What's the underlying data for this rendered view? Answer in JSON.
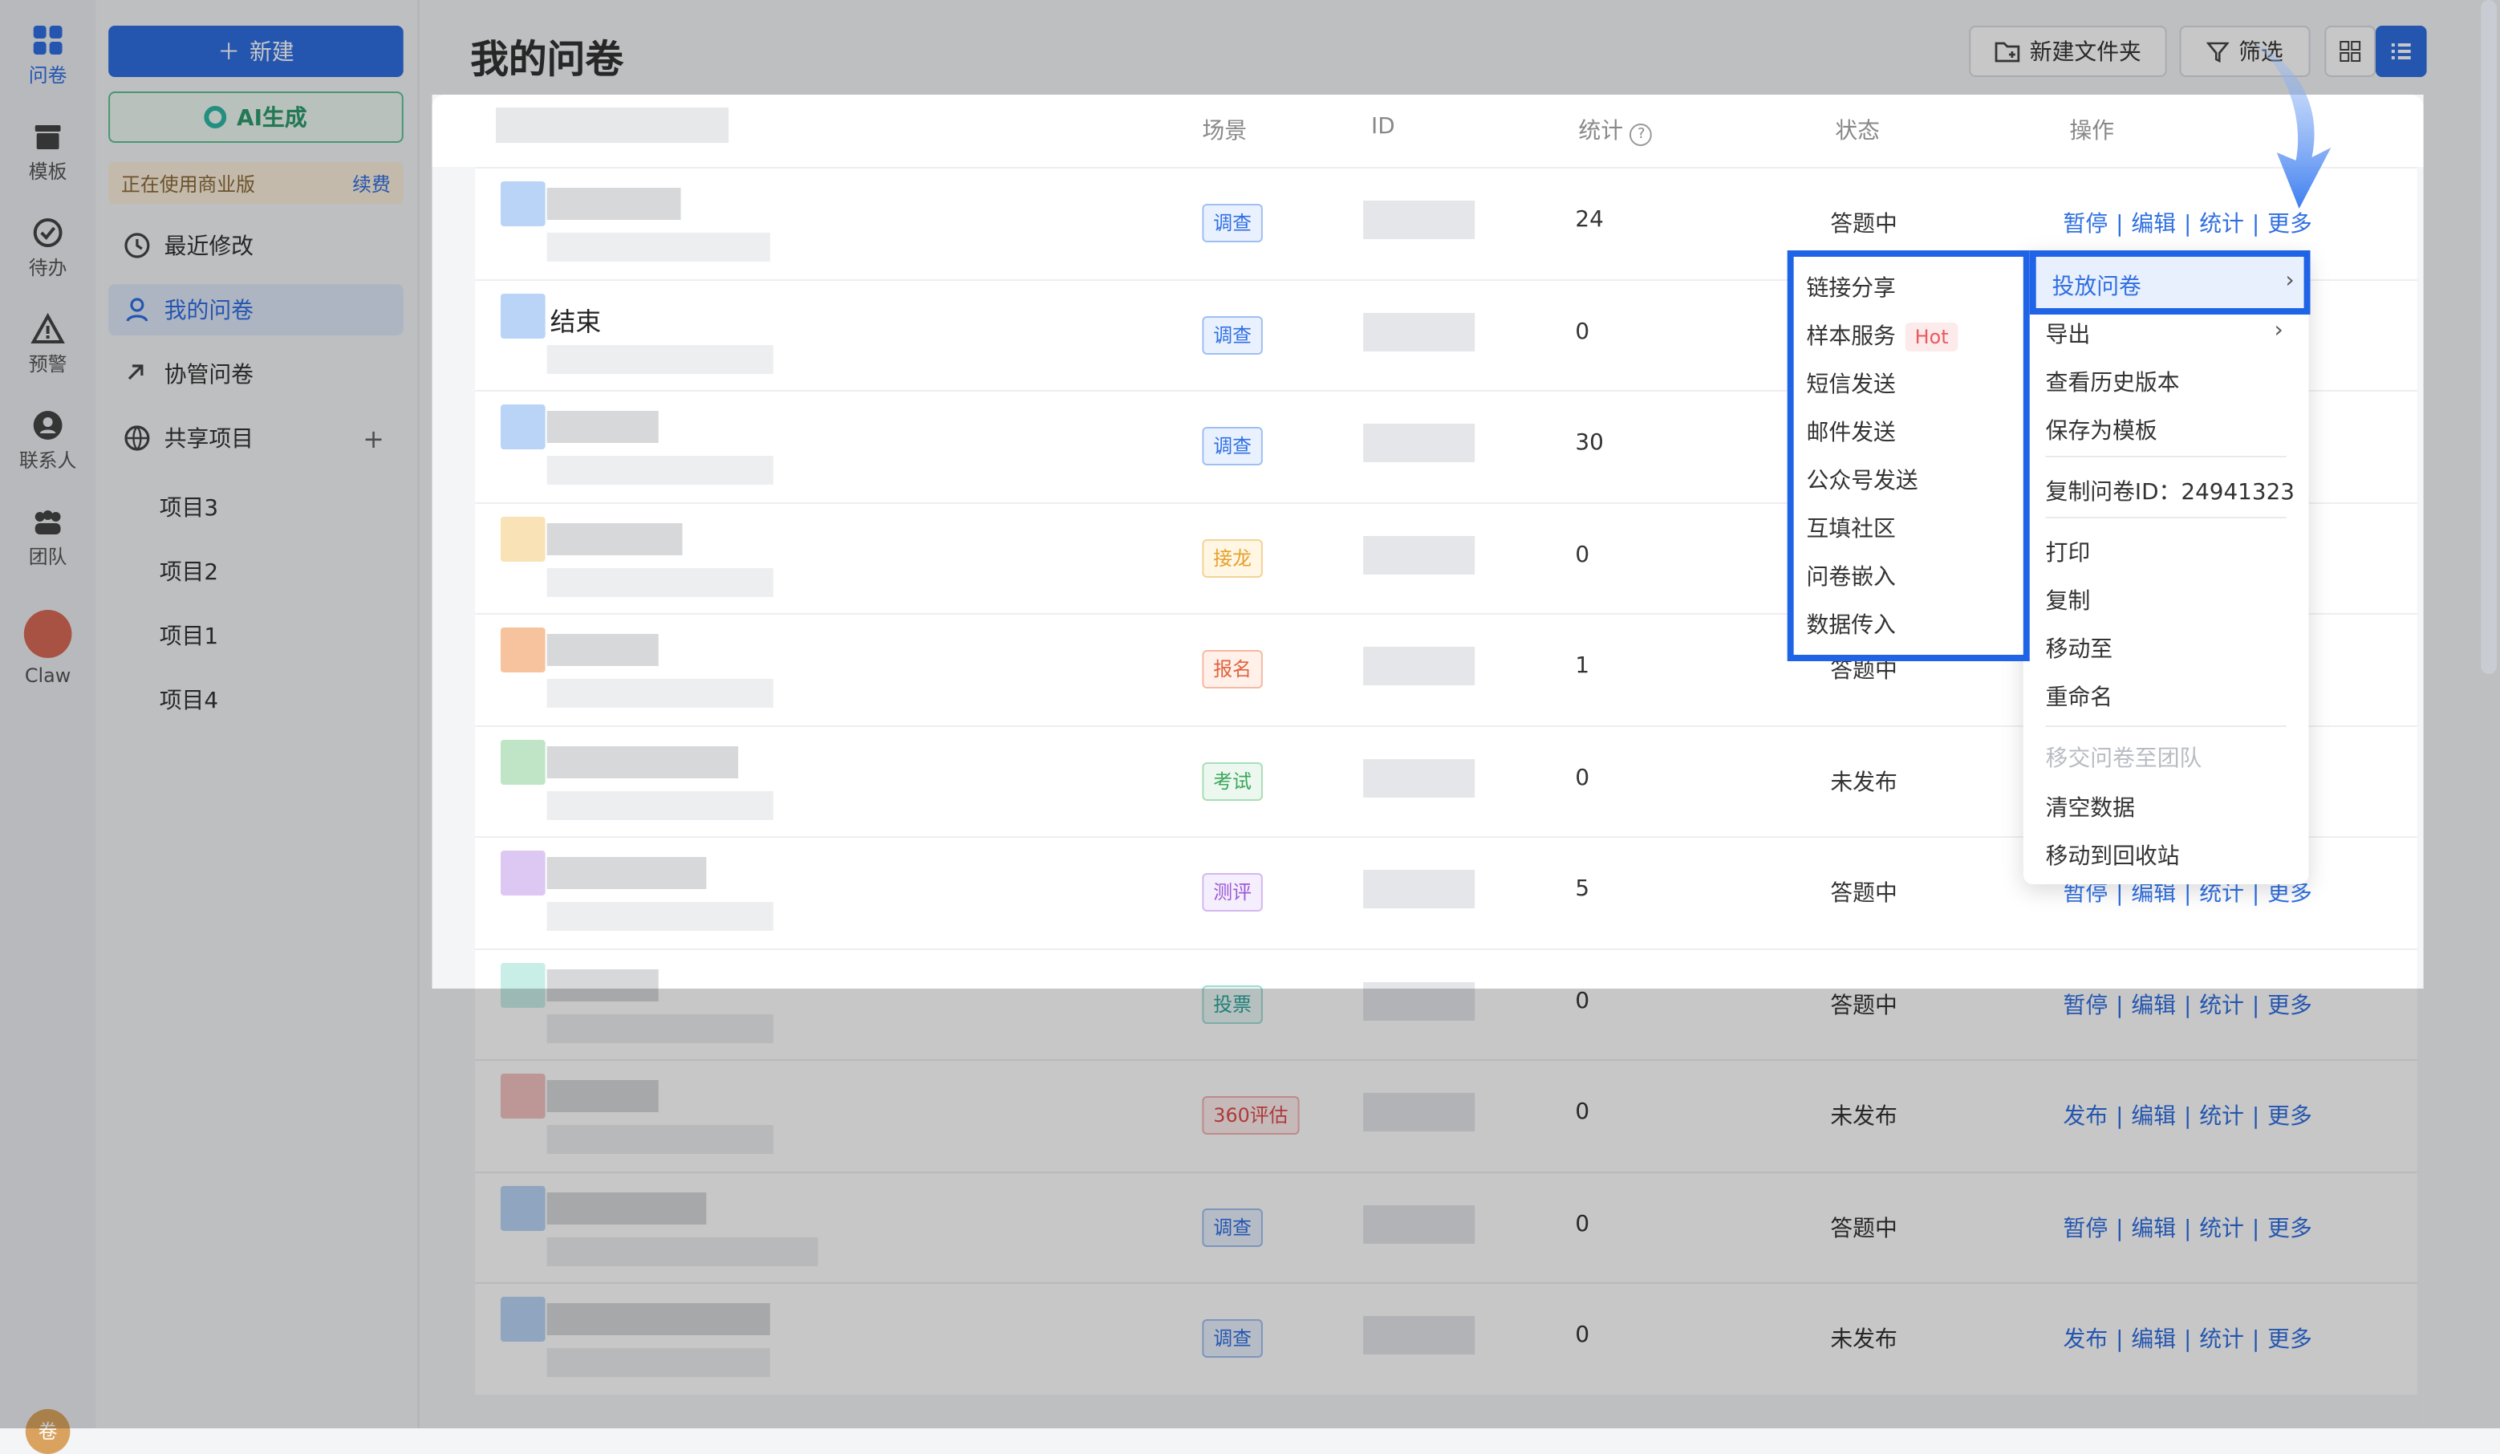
{
  "rail": {
    "items": [
      {
        "label": "问卷",
        "icon": "grid-icon"
      },
      {
        "label": "模板",
        "icon": "template-icon"
      },
      {
        "label": "待办",
        "icon": "check-circle-icon"
      },
      {
        "label": "预警",
        "icon": "warning-icon"
      },
      {
        "label": "联系人",
        "icon": "contact-icon"
      },
      {
        "label": "团队",
        "icon": "team-icon"
      },
      {
        "label": "Claw",
        "icon": "claw-icon"
      }
    ],
    "bottom_avatar_text": "卷"
  },
  "sidebar": {
    "new_button": "新建",
    "ai_button": "AI生成",
    "business": {
      "text": "正在使用商业版",
      "renew": "续费"
    },
    "nav": [
      {
        "label": "最近修改"
      },
      {
        "label": "我的问卷"
      },
      {
        "label": "协管问卷"
      },
      {
        "label": "共享项目"
      }
    ],
    "projects": [
      "项目3",
      "项目2",
      "项目1",
      "项目4"
    ]
  },
  "header": {
    "title": "我的问卷",
    "new_folder": "新建文件夹",
    "filter": "筛选"
  },
  "table": {
    "columns": {
      "scene": "场景",
      "id": "ID",
      "stats": "统计",
      "status": "状态",
      "ops": "操作"
    },
    "rows": [
      {
        "title": "",
        "tag": "调查",
        "stat": "24",
        "status": "答题中",
        "ops": [
          "暂停",
          "编辑",
          "统计",
          "更多"
        ]
      },
      {
        "title": "结束",
        "tag": "调查",
        "stat": "0",
        "status": "",
        "ops": []
      },
      {
        "title": "",
        "tag": "调查",
        "stat": "30",
        "status": "",
        "ops": []
      },
      {
        "title": "",
        "tag": "接龙",
        "stat": "0",
        "status": "",
        "ops": []
      },
      {
        "title": "",
        "tag": "报名",
        "stat": "1",
        "status": "答题中",
        "ops": []
      },
      {
        "title": "",
        "tag": "考试",
        "stat": "0",
        "status": "未发布",
        "ops": []
      },
      {
        "title": "",
        "tag": "测评",
        "stat": "5",
        "status": "答题中",
        "ops": [
          "暂停",
          "编辑",
          "统计",
          "更多"
        ]
      },
      {
        "title": "",
        "tag": "投票",
        "stat": "0",
        "status": "答题中",
        "ops": [
          "暂停",
          "编辑",
          "统计",
          "更多"
        ]
      },
      {
        "title": "",
        "tag": "360评估",
        "stat": "0",
        "status": "未发布",
        "ops": [
          "发布",
          "编辑",
          "统计",
          "更多"
        ]
      },
      {
        "title": "",
        "tag": "调查",
        "stat": "0",
        "status": "答题中",
        "ops": [
          "暂停",
          "编辑",
          "统计",
          "更多"
        ]
      },
      {
        "title": "",
        "tag": "调查",
        "stat": "0",
        "status": "未发布",
        "ops": [
          "发布",
          "编辑",
          "统计",
          "更多"
        ]
      }
    ]
  },
  "menu": {
    "highlight": "投放问卷",
    "items": [
      "导出",
      "查看历史版本",
      "保存为模板",
      "复制问卷ID：24941323",
      "打印",
      "复制",
      "移动至",
      "重命名",
      "移交问卷至团队",
      "清空数据",
      "移动到回收站"
    ],
    "sub": [
      "链接分享",
      "样本服务",
      "短信发送",
      "邮件发送",
      "公众号发送",
      "互填社区",
      "问卷嵌入",
      "数据传入"
    ],
    "hot": "Hot"
  },
  "colors": {
    "accent": "#2f6fe2",
    "highlight_border": "#1f63e6"
  }
}
